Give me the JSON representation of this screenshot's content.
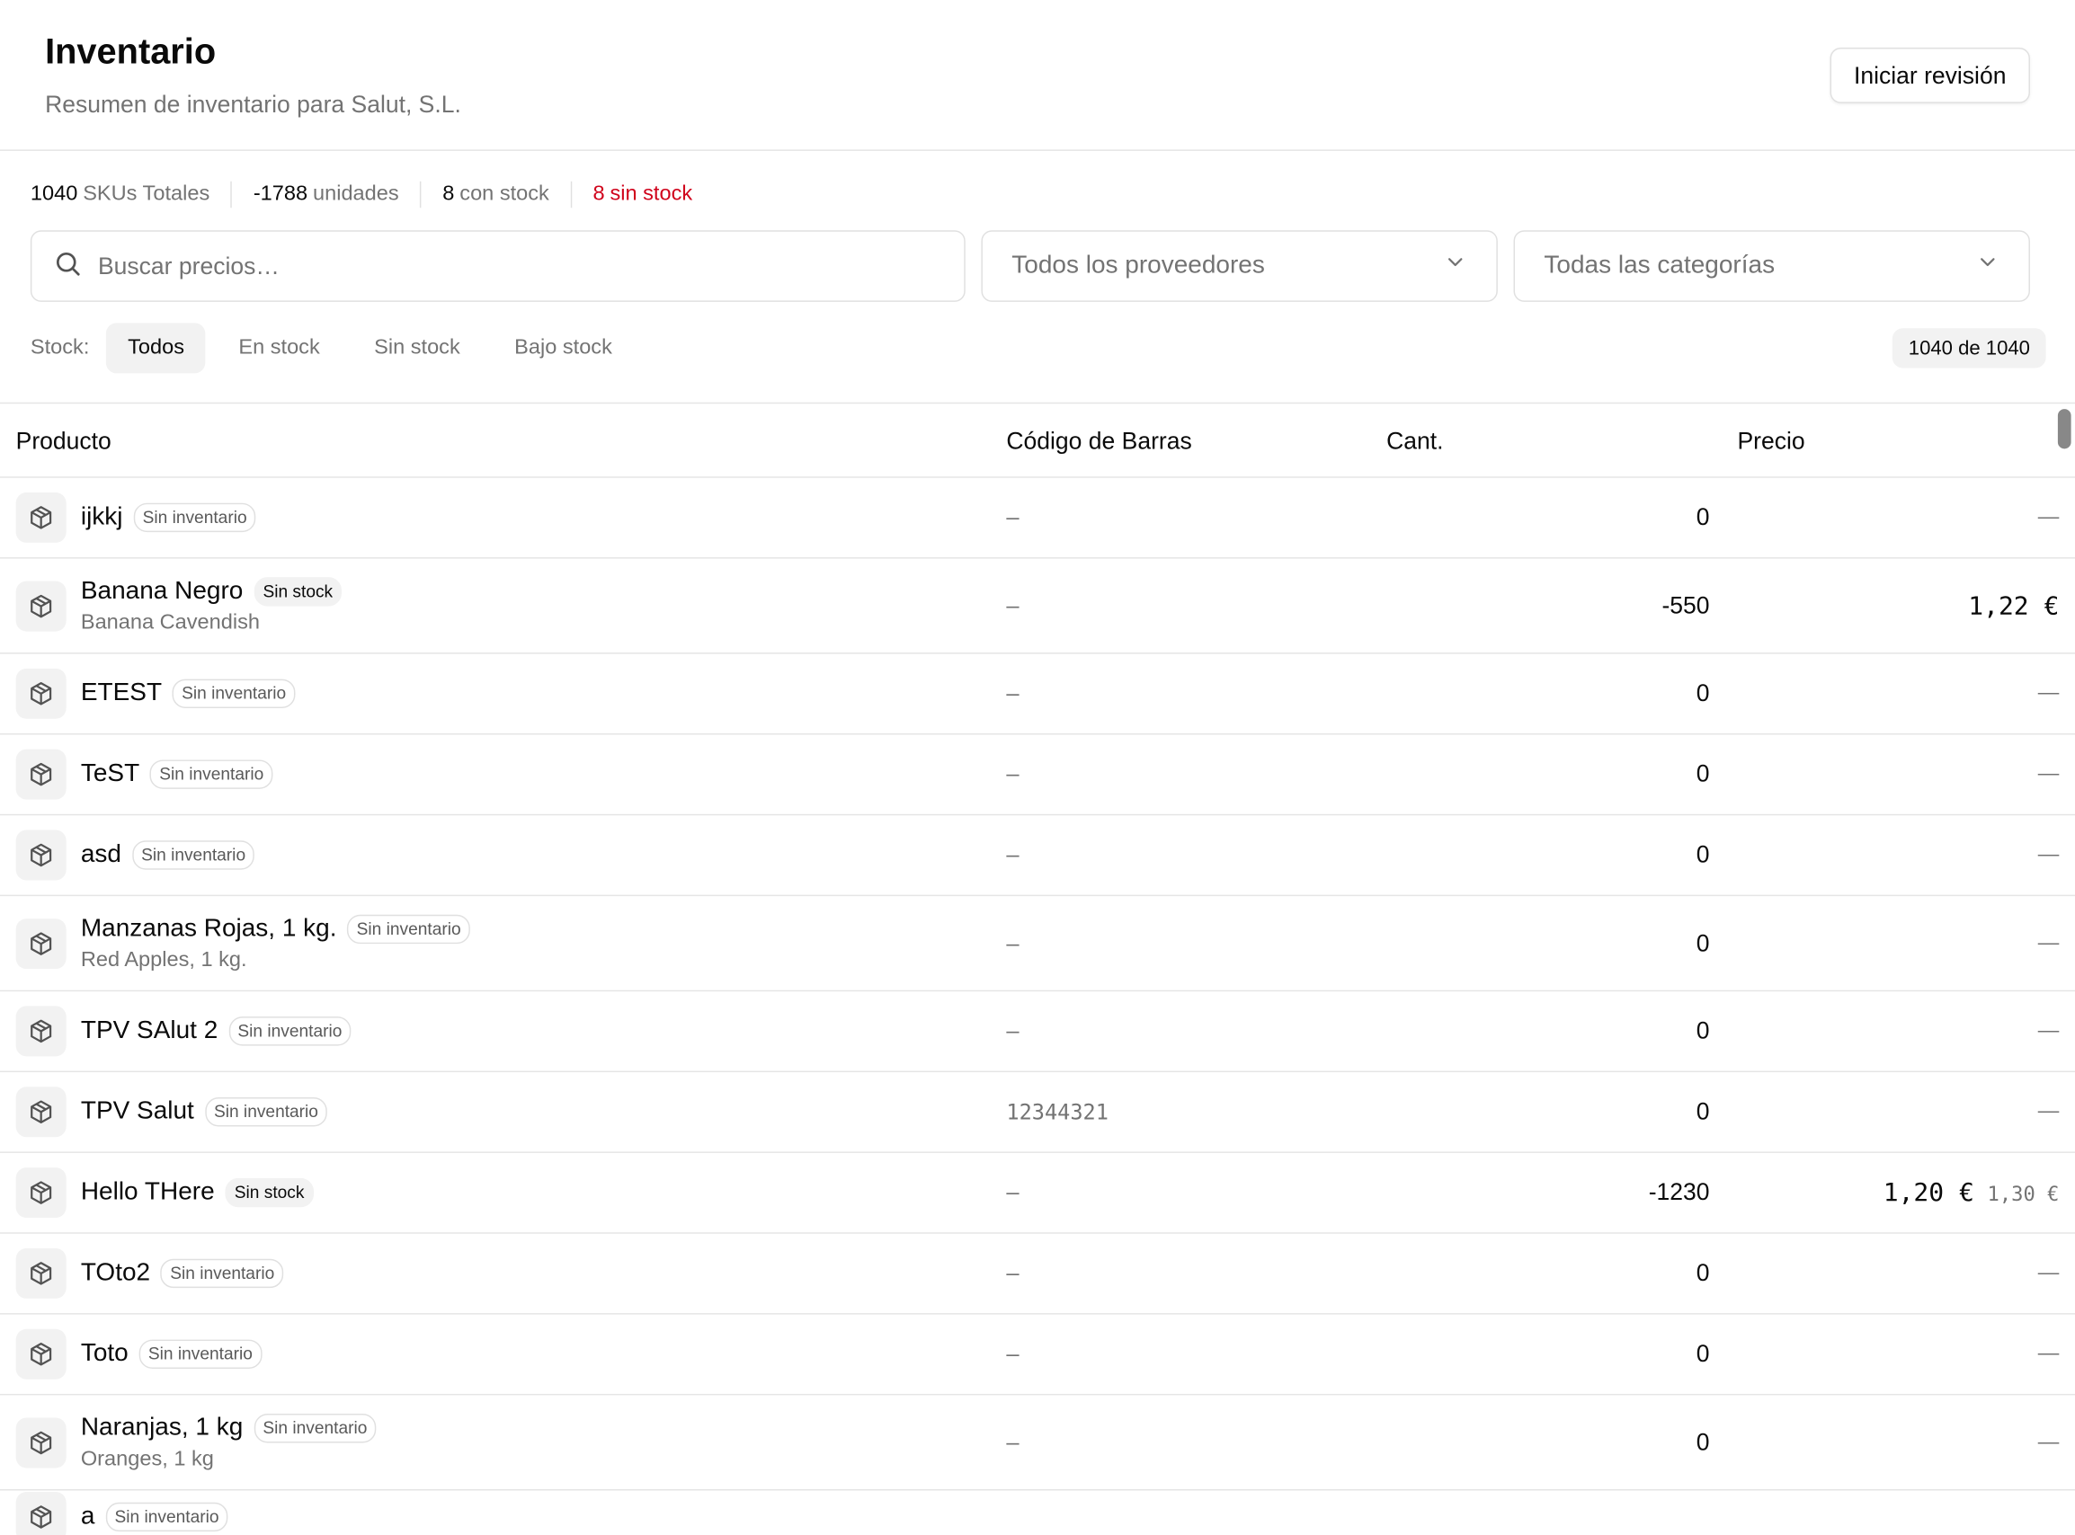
{
  "header": {
    "title": "Inventario",
    "subtitle": "Resumen de inventario para Salut, S.L.",
    "review_button": "Iniciar revisión"
  },
  "stats": {
    "skus_num": "1040",
    "skus_label": "SKUs Totales",
    "units_num": "-1788",
    "units_label": "unidades",
    "instock_num": "8",
    "instock_label": "con stock",
    "outstock_num": "8",
    "outstock_label": "sin stock",
    "alert_color": "#d0021b"
  },
  "filters": {
    "search_placeholder": "Buscar precios…",
    "supplier_select": "Todos los proveedores",
    "category_select": "Todas las categorías"
  },
  "stock_filter": {
    "label": "Stock:",
    "tabs": [
      "Todos",
      "En stock",
      "Sin stock",
      "Bajo stock"
    ],
    "active": "Todos",
    "count": "1040 de 1040"
  },
  "table": {
    "columns": [
      "Producto",
      "Código de Barras",
      "Cant.",
      "Precio"
    ],
    "rows": [
      {
        "name": "ijkkj",
        "badge": "Sin inventario",
        "sub": "",
        "barcode": "–",
        "qty": "0",
        "price": "—",
        "old_price": ""
      },
      {
        "name": "Banana Negro",
        "badge": "Sin stock",
        "sub": "Banana Cavendish",
        "barcode": "–",
        "qty": "-550",
        "price": "1,22 €",
        "old_price": ""
      },
      {
        "name": "ETEST",
        "badge": "Sin inventario",
        "sub": "",
        "barcode": "–",
        "qty": "0",
        "price": "—",
        "old_price": ""
      },
      {
        "name": "TeST",
        "badge": "Sin inventario",
        "sub": "",
        "barcode": "–",
        "qty": "0",
        "price": "—",
        "old_price": ""
      },
      {
        "name": "asd",
        "badge": "Sin inventario",
        "sub": "",
        "barcode": "–",
        "qty": "0",
        "price": "—",
        "old_price": ""
      },
      {
        "name": "Manzanas Rojas, 1 kg.",
        "badge": "Sin inventario",
        "sub": "Red Apples, 1 kg.",
        "barcode": "–",
        "qty": "0",
        "price": "—",
        "old_price": ""
      },
      {
        "name": "TPV SAlut 2",
        "badge": "Sin inventario",
        "sub": "",
        "barcode": "–",
        "qty": "0",
        "price": "—",
        "old_price": ""
      },
      {
        "name": "TPV Salut",
        "badge": "Sin inventario",
        "sub": "",
        "barcode": "12344321",
        "qty": "0",
        "price": "—",
        "old_price": ""
      },
      {
        "name": "Hello THere",
        "badge": "Sin stock",
        "sub": "",
        "barcode": "–",
        "qty": "-1230",
        "price": "1,20 €",
        "old_price": "1,30 €"
      },
      {
        "name": "TOto2",
        "badge": "Sin inventario",
        "sub": "",
        "barcode": "–",
        "qty": "0",
        "price": "—",
        "old_price": ""
      },
      {
        "name": "Toto",
        "badge": "Sin inventario",
        "sub": "",
        "barcode": "–",
        "qty": "0",
        "price": "—",
        "old_price": ""
      },
      {
        "name": "Naranjas, 1 kg",
        "badge": "Sin inventario",
        "sub": "Oranges, 1 kg",
        "barcode": "–",
        "qty": "0",
        "price": "—",
        "old_price": ""
      },
      {
        "name": "a",
        "badge": "Sin inventario",
        "sub": "",
        "barcode": "",
        "qty": "",
        "price": "",
        "old_price": ""
      }
    ]
  }
}
